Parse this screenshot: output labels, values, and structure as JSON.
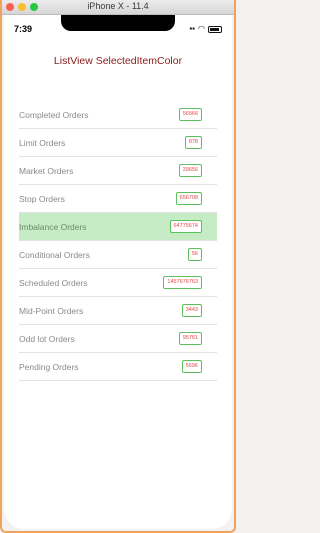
{
  "window": {
    "title": "iPhone X - 11.4"
  },
  "status_bar": {
    "time": "7:39"
  },
  "page": {
    "title": "ListView SelectedItemColor"
  },
  "list": {
    "selected_index": 4,
    "selected_color": "#c5ecc5",
    "badge_text_color": "#e24a4a",
    "badge_border_color": "#5bbf5b",
    "items": [
      {
        "label": "Completed Orders",
        "value": "56566"
      },
      {
        "label": "Limit Orders",
        "value": "878"
      },
      {
        "label": "Market Orders",
        "value": "39656"
      },
      {
        "label": "Stop Orders",
        "value": "656708"
      },
      {
        "label": "Imbalance Orders",
        "value": "64775674"
      },
      {
        "label": "Conditional Orders",
        "value": "56"
      },
      {
        "label": "Scheduled Orders",
        "value": "1457676763"
      },
      {
        "label": "Mid-Point Orders",
        "value": "3443"
      },
      {
        "label": "Odd lot Orders",
        "value": "95761"
      },
      {
        "label": "Pending Orders",
        "value": "5696"
      }
    ]
  }
}
